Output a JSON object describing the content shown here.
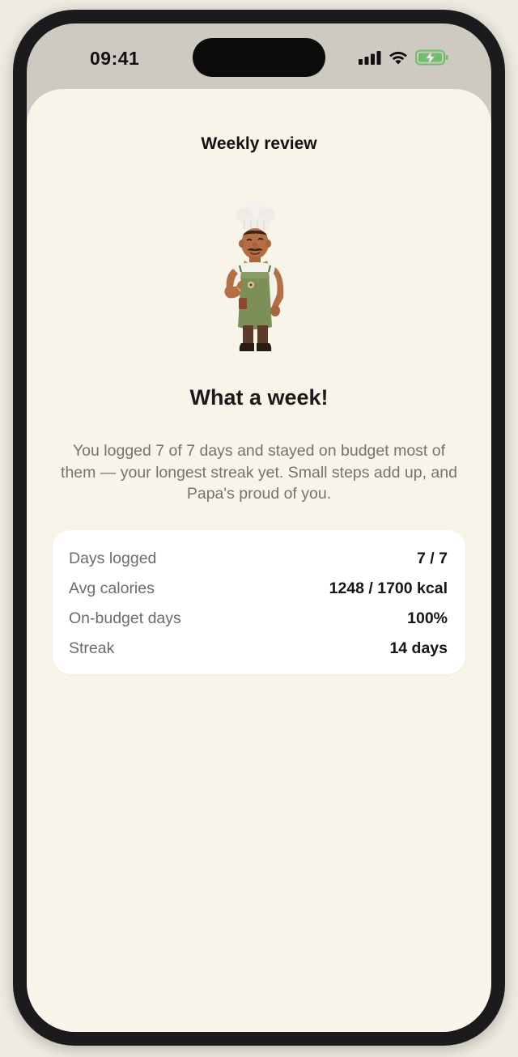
{
  "status_bar": {
    "time": "09:41",
    "icons": [
      "cellular-signal-icon",
      "wifi-icon",
      "battery-charging-icon"
    ],
    "battery_color": "#6dbf6a"
  },
  "header": {
    "title": "Weekly review"
  },
  "mascot": {
    "icon": "chef-mascot-thumbs-up"
  },
  "main": {
    "headline": "What a week!",
    "message": "You logged 7 of 7 days and stayed on budget most of them — your longest streak yet. Small steps add up, and Papa's proud of you."
  },
  "stats": [
    {
      "label": "Days logged",
      "value": "7 / 7"
    },
    {
      "label": "Avg calories",
      "value": "1248 / 1700 kcal"
    },
    {
      "label": "On-budget days",
      "value": "100%"
    },
    {
      "label": "Streak",
      "value": "14 days"
    }
  ],
  "colors": {
    "sheet_background": "#f9f4ea",
    "top_background": "#cfcac1",
    "card_background": "#ffffff",
    "frame": "#1b1b1d"
  }
}
